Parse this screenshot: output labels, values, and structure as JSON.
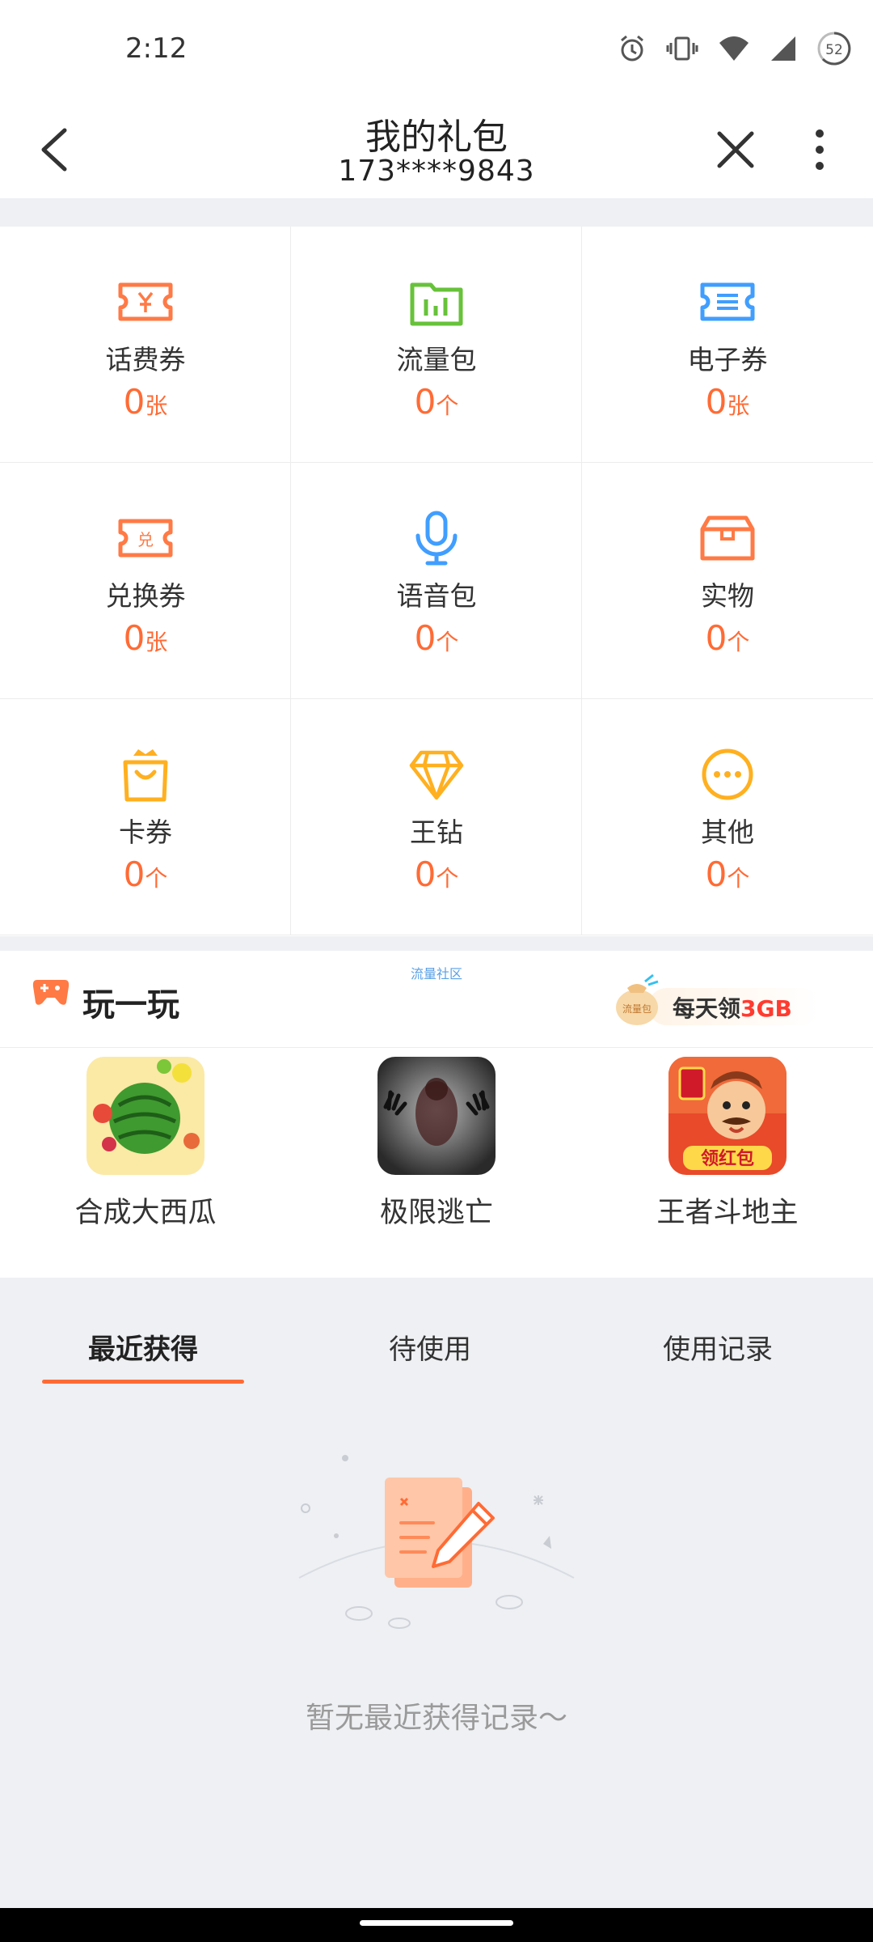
{
  "status_bar": {
    "time": "2:12",
    "battery": "52",
    "icons": [
      "alarm-icon",
      "vibrate-icon",
      "wifi-icon",
      "signal-icon",
      "battery-icon"
    ]
  },
  "header": {
    "title": "我的礼包",
    "subtitle": "173****9843",
    "back_icon": "chevron-left-icon",
    "close_icon": "close-icon",
    "more_icon": "more-vertical-icon"
  },
  "benefits": [
    {
      "label": "话费券",
      "count": "0",
      "unit": "张",
      "icon": "coupon-yen-icon",
      "color": "#ff7a45"
    },
    {
      "label": "流量包",
      "count": "0",
      "unit": "个",
      "icon": "data-pack-icon",
      "color": "#67c23a"
    },
    {
      "label": "电子券",
      "count": "0",
      "unit": "张",
      "icon": "e-coupon-icon",
      "color": "#409eff"
    },
    {
      "label": "兑换券",
      "count": "0",
      "unit": "张",
      "icon": "exchange-coupon-icon",
      "color": "#ff7a45"
    },
    {
      "label": "语音包",
      "count": "0",
      "unit": "个",
      "icon": "microphone-icon",
      "color": "#409eff"
    },
    {
      "label": "实物",
      "count": "0",
      "unit": "个",
      "icon": "box-icon",
      "color": "#ff7a45"
    },
    {
      "label": "卡券",
      "count": "0",
      "unit": "个",
      "icon": "shopping-bag-crown-icon",
      "color": "#ffb020"
    },
    {
      "label": "王钻",
      "count": "0",
      "unit": "个",
      "icon": "diamond-icon",
      "color": "#ffb020"
    },
    {
      "label": "其他",
      "count": "0",
      "unit": "个",
      "icon": "more-circle-icon",
      "color": "#ffb020"
    }
  ],
  "play": {
    "title": "玩一玩",
    "community_label": "流量社区",
    "promo": {
      "bag_label": "流量包",
      "text_prefix": "每天领",
      "text_highlight": "3GB"
    },
    "games": [
      {
        "name": "合成大西瓜",
        "icon": "watermelon-game-icon"
      },
      {
        "name": "极限逃亡",
        "icon": "escape-game-icon"
      },
      {
        "name": "王者斗地主",
        "icon": "landlord-game-icon",
        "badge": "领红包"
      }
    ]
  },
  "tabs": [
    {
      "label": "最近获得",
      "active": true
    },
    {
      "label": "待使用",
      "active": false
    },
    {
      "label": "使用记录",
      "active": false
    }
  ],
  "empty_state": {
    "message": "暂无最近获得记录～",
    "icon": "empty-document-pencil-icon"
  },
  "colors": {
    "accent": "#ff6b35",
    "background": "#eef0f3",
    "card": "#ffffff"
  }
}
